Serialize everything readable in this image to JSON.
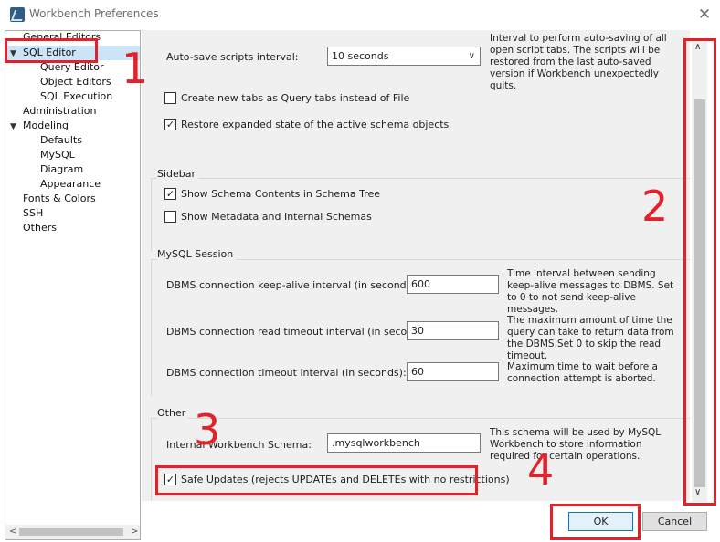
{
  "window": {
    "title": "Workbench Preferences"
  },
  "sidebar": {
    "items": [
      {
        "label": "General Editors",
        "level": 1,
        "expanded": null
      },
      {
        "label": "SQL Editor",
        "level": 0,
        "expanded": true,
        "selected": true
      },
      {
        "label": "Query Editor",
        "level": 2
      },
      {
        "label": "Object Editors",
        "level": 2
      },
      {
        "label": "SQL Execution",
        "level": 2
      },
      {
        "label": "Administration",
        "level": 1
      },
      {
        "label": "Modeling",
        "level": 0,
        "expanded": true
      },
      {
        "label": "Defaults",
        "level": 2
      },
      {
        "label": "MySQL",
        "level": 2
      },
      {
        "label": "Diagram",
        "level": 2
      },
      {
        "label": "Appearance",
        "level": 2
      },
      {
        "label": "Fonts & Colors",
        "level": 1
      },
      {
        "label": "SSH",
        "level": 1
      },
      {
        "label": "Others",
        "level": 1
      }
    ]
  },
  "main": {
    "autosave": {
      "label": "Auto-save scripts interval:",
      "value": "10 seconds",
      "description": "Interval to perform auto-saving of all open script tabs. The scripts will be restored from the last auto-saved version if Workbench unexpectedly quits."
    },
    "new_tabs_query": {
      "label": "Create new tabs as Query tabs instead of File",
      "checked": false
    },
    "restore_schema": {
      "label": "Restore expanded state of the active schema objects",
      "checked": true
    },
    "sidebar_group": {
      "title": "Sidebar",
      "show_schema_contents": {
        "label": "Show Schema Contents in Schema Tree",
        "checked": true
      },
      "show_metadata": {
        "label": "Show Metadata and Internal Schemas",
        "checked": false
      }
    },
    "session_group": {
      "title": "MySQL Session",
      "keepalive": {
        "label": "DBMS connection keep-alive interval (in seconds):",
        "value": "600",
        "description": "Time interval between sending keep-alive messages to DBMS. Set to 0 to not send keep-alive messages."
      },
      "read_timeout": {
        "label": "DBMS connection read timeout interval (in seconds):",
        "value": "30",
        "description": "The maximum amount of time the query can take to return data from the DBMS.Set 0 to skip the read timeout."
      },
      "conn_timeout": {
        "label": "DBMS connection timeout interval (in seconds):",
        "value": "60",
        "description": "Maximum time to wait before a connection attempt is aborted."
      }
    },
    "other_group": {
      "title": "Other",
      "internal_schema": {
        "label": "Internal Workbench Schema:",
        "value": ".mysqlworkbench",
        "description": "This schema will be used by MySQL Workbench to store information required for certain operations."
      },
      "safe_updates": {
        "label": "Safe Updates (rejects UPDATEs and DELETEs with no restrictions)",
        "checked": true
      }
    }
  },
  "buttons": {
    "ok": "OK",
    "cancel": "Cancel"
  },
  "annotations": {
    "n1": "1",
    "n2": "2",
    "n3": "3",
    "n4": "4",
    "color": "#e3212b"
  },
  "icons": {
    "close": "close-icon",
    "app": "workbench-logo-icon",
    "check": "✓"
  }
}
